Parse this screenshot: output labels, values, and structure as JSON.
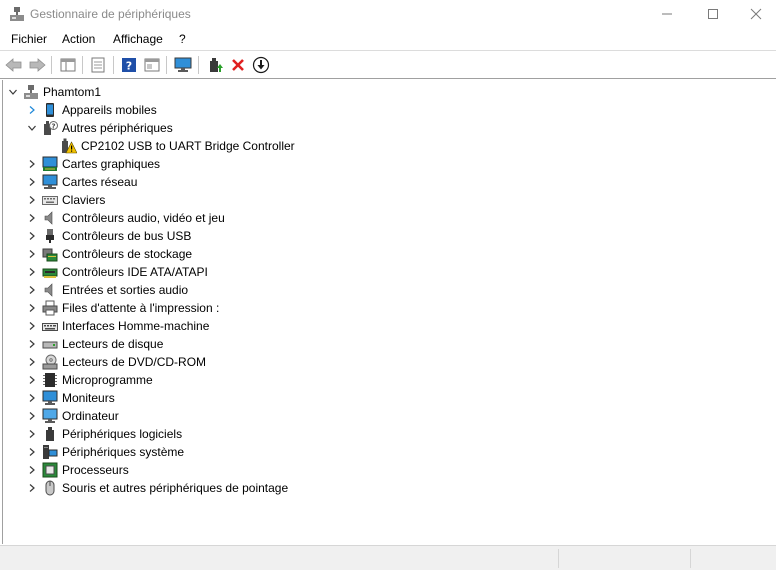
{
  "window": {
    "title": "Gestionnaire de périphériques",
    "app_icon": "device-manager-icon"
  },
  "menubar": {
    "items": [
      "Fichier",
      "Action",
      "Affichage",
      "?"
    ]
  },
  "toolbar": {
    "buttons": [
      "back-arrow-icon",
      "forward-arrow-icon",
      "show-hide-console-tree-icon",
      "properties-icon",
      "help-icon",
      "view-icon",
      "scan-hardware-icon",
      "update-driver-icon",
      "uninstall-icon",
      "disable-device-icon"
    ]
  },
  "tree": {
    "root": {
      "label": "Phamtom1",
      "icon": "computer-icon",
      "expanded": true
    },
    "categories": [
      {
        "label": "Appareils mobiles",
        "icon": "mobile-device-icon",
        "expanded": false
      },
      {
        "label": "Autres périphériques",
        "icon": "unknown-device-icon",
        "expanded": true,
        "children": [
          {
            "label": "CP2102 USB to UART Bridge Controller",
            "icon": "warning-device-icon"
          }
        ]
      },
      {
        "label": "Cartes graphiques",
        "icon": "display-adapter-icon",
        "expanded": false
      },
      {
        "label": "Cartes réseau",
        "icon": "network-adapter-icon",
        "expanded": false
      },
      {
        "label": "Claviers",
        "icon": "keyboard-icon",
        "expanded": false
      },
      {
        "label": "Contrôleurs audio, vidéo et jeu",
        "icon": "speaker-icon",
        "expanded": false
      },
      {
        "label": "Contrôleurs de bus USB",
        "icon": "usb-icon",
        "expanded": false
      },
      {
        "label": "Contrôleurs de stockage",
        "icon": "storage-controller-icon",
        "expanded": false
      },
      {
        "label": "Contrôleurs IDE ATA/ATAPI",
        "icon": "ide-controller-icon",
        "expanded": false
      },
      {
        "label": "Entrées et sorties audio",
        "icon": "audio-io-icon",
        "expanded": false
      },
      {
        "label": "Files d'attente à l'impression :",
        "icon": "printer-icon",
        "expanded": false
      },
      {
        "label": "Interfaces Homme-machine",
        "icon": "hid-icon",
        "expanded": false
      },
      {
        "label": "Lecteurs de disque",
        "icon": "disk-drive-icon",
        "expanded": false
      },
      {
        "label": "Lecteurs de DVD/CD-ROM",
        "icon": "dvd-drive-icon",
        "expanded": false
      },
      {
        "label": "Microprogramme",
        "icon": "firmware-icon",
        "expanded": false
      },
      {
        "label": "Moniteurs",
        "icon": "monitor-icon",
        "expanded": false
      },
      {
        "label": "Ordinateur",
        "icon": "computer-monitor-icon",
        "expanded": false
      },
      {
        "label": "Périphériques logiciels",
        "icon": "software-device-icon",
        "expanded": false
      },
      {
        "label": "Périphériques système",
        "icon": "system-device-icon",
        "expanded": false
      },
      {
        "label": "Processeurs",
        "icon": "processor-icon",
        "expanded": false
      },
      {
        "label": "Souris et autres périphériques de pointage",
        "icon": "mouse-icon",
        "expanded": false
      }
    ]
  },
  "colors": {
    "accent_blue": "#1e88d8",
    "uninstall_red": "#e02020",
    "warning_yellow": "#f2c200"
  }
}
